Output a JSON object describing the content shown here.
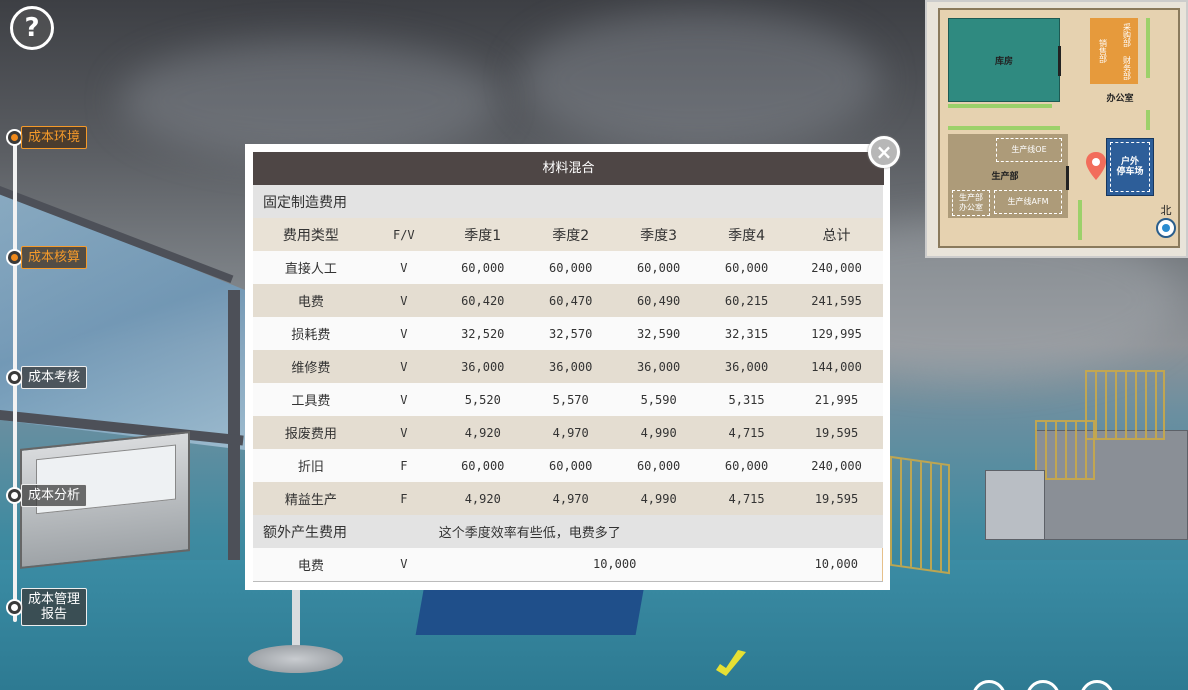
{
  "help": {
    "symbol": "?"
  },
  "nav": {
    "items": [
      {
        "label": "成本环境",
        "active": true
      },
      {
        "label": "成本核算",
        "active": true
      },
      {
        "label": "成本考核",
        "active": false
      },
      {
        "label": "成本分析",
        "active": false
      },
      {
        "label": "成本管理\n报告",
        "active": false
      }
    ]
  },
  "minimap": {
    "warehouse": "库房",
    "sales": "销售部",
    "purchase": "采购部",
    "finance": "财务部",
    "office": "办公室",
    "production": "生产部",
    "line_oe": "生产线OE",
    "line_afm": "生产线AFM",
    "prod_office": "生产部\n办公室",
    "parking": "户外\n停车场",
    "north": "北"
  },
  "dialog": {
    "title": "材料混合",
    "close_symbol": "×",
    "section_fixed": "固定制造费用",
    "headers": [
      "费用类型",
      "F/V",
      "季度1",
      "季度2",
      "季度3",
      "季度4",
      "总计"
    ],
    "rows": [
      [
        "直接人工",
        "V",
        "60,000",
        "60,000",
        "60,000",
        "60,000",
        "240,000"
      ],
      [
        "电费",
        "V",
        "60,420",
        "60,470",
        "60,490",
        "60,215",
        "241,595"
      ],
      [
        "损耗费",
        "V",
        "32,520",
        "32,570",
        "32,590",
        "32,315",
        "129,995"
      ],
      [
        "维修费",
        "V",
        "36,000",
        "36,000",
        "36,000",
        "36,000",
        "144,000"
      ],
      [
        "工具费",
        "V",
        "5,520",
        "5,570",
        "5,590",
        "5,315",
        "21,995"
      ],
      [
        "报废费用",
        "V",
        "4,920",
        "4,970",
        "4,990",
        "4,715",
        "19,595"
      ],
      [
        "折旧",
        "F",
        "60,000",
        "60,000",
        "60,000",
        "60,000",
        "240,000"
      ],
      [
        "精益生产",
        "F",
        "4,920",
        "4,970",
        "4,990",
        "4,715",
        "19,595"
      ]
    ],
    "extra": {
      "label": "额外产生费用",
      "note": "这个季度效率有些低，电费多了",
      "row": {
        "type": "电费",
        "fv": "V",
        "amount": "10,000",
        "total": "10,000"
      }
    }
  }
}
